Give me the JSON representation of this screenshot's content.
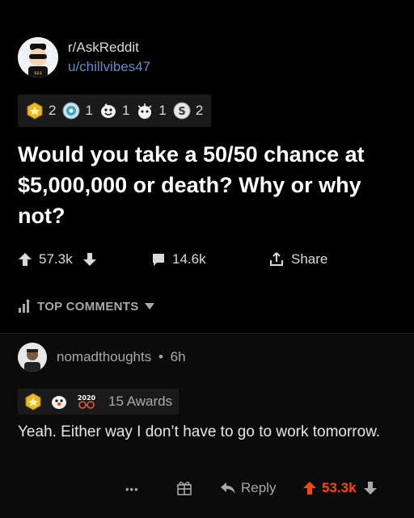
{
  "post": {
    "subreddit": "r/AskReddit",
    "username": "u/chillvibes47",
    "awards": [
      {
        "icon": "gold-award-icon",
        "count": "2"
      },
      {
        "icon": "platinum-award-icon",
        "count": "1"
      },
      {
        "icon": "wholesome-award-icon",
        "count": "1"
      },
      {
        "icon": "helpful-award-icon",
        "count": "1"
      },
      {
        "icon": "silver-award-icon",
        "count": "2"
      }
    ],
    "title": "Would you take a 50/50 chance at $5,000,000 or death? Why or why not?",
    "upvotes": "57.3k",
    "comments": "14.6k",
    "share_label": "Share"
  },
  "sort": {
    "label": "TOP COMMENTS"
  },
  "comment": {
    "username": "nomadthoughts",
    "separator": "•",
    "time": "6h",
    "award_icons": [
      "gold-award-icon",
      "wholesome-award-icon",
      "2020-award-icon"
    ],
    "awards_label": "15 Awards",
    "body": "Yeah. Either way I don’t have to go to work tomorrow.",
    "more_label": "•••",
    "reply_label": "Reply",
    "score": "53.3k"
  },
  "colors": {
    "background": "#000000",
    "accent_upvote": "#ff4500",
    "username_link": "#5b8ed6"
  }
}
